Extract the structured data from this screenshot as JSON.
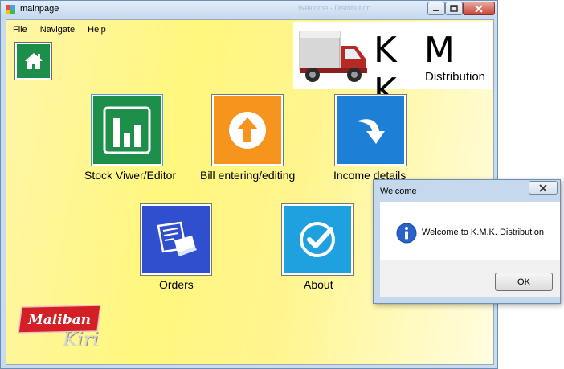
{
  "window": {
    "title": "mainpage",
    "background_title": "Welcome - Distribution"
  },
  "menu": {
    "items": [
      "File",
      "Navigate",
      "Help"
    ]
  },
  "logo": {
    "letters": "K M K",
    "subtitle": "Distribution"
  },
  "tiles": [
    {
      "label": "Stock Viwer/Editor",
      "color": "#1d8f4b",
      "icon": "bar-chart-icon"
    },
    {
      "label": "Bill entering/editing",
      "color": "#f7941d",
      "icon": "upload-arrow-icon"
    },
    {
      "label": "Income details",
      "color": "#1e7fd6",
      "icon": "download-arrow-icon"
    },
    {
      "label": "Orders",
      "color": "#2f4fcf",
      "icon": "orders-icon"
    },
    {
      "label": "About",
      "color": "#1fa1e0",
      "icon": "checkmark-icon"
    }
  ],
  "brand": {
    "maliban": "Maliban",
    "kiri": "Kiri"
  },
  "dialog": {
    "title": "Welcome",
    "message": "Welcome to K.M.K. Distribution",
    "ok_label": "OK"
  }
}
